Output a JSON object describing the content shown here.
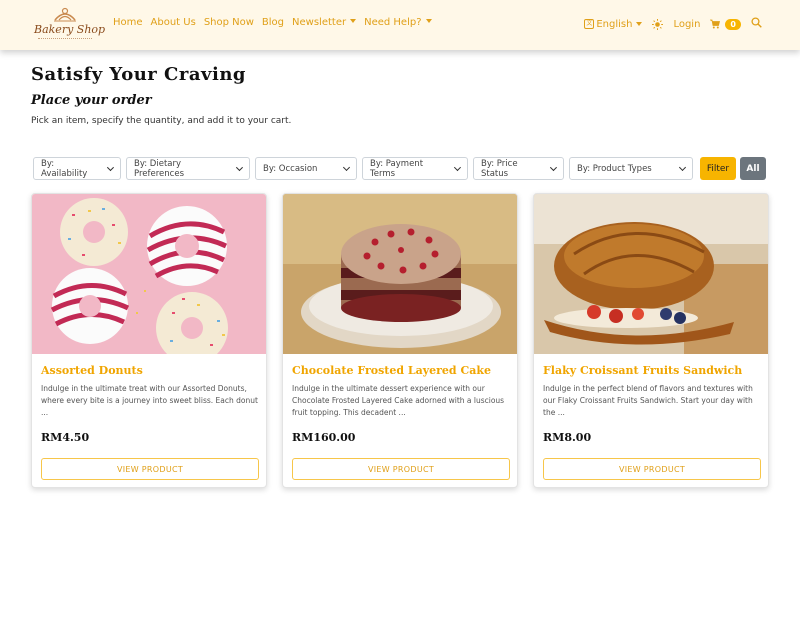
{
  "nav": {
    "logo_text": "Bakery Shop",
    "links": [
      {
        "label": "Home",
        "dropdown": false
      },
      {
        "label": "About Us",
        "dropdown": false
      },
      {
        "label": "Shop Now",
        "dropdown": false
      },
      {
        "label": "Blog",
        "dropdown": false
      },
      {
        "label": "Newsletter",
        "dropdown": true
      },
      {
        "label": "Need Help?",
        "dropdown": true
      }
    ],
    "language": "English",
    "login": "Login",
    "cart_count": "0",
    "icons": [
      "language-icon",
      "sun-icon",
      "cart-icon",
      "search-icon"
    ]
  },
  "header": {
    "title": "Satisfy Your Craving",
    "subtitle": "Place your order",
    "description": "Pick an item, specify the quantity, and add it to your cart."
  },
  "filters": {
    "selects": [
      "By: Availability",
      "By: Dietary Preferences",
      "By: Occasion",
      "By: Payment Terms",
      "By: Price Status",
      "By: Product Types"
    ],
    "filter_button": "Filter",
    "all_button": "All"
  },
  "products": [
    {
      "name": "Assorted Donuts",
      "description": "Indulge in the ultimate treat with our Assorted Donuts, where every bite is a journey into sweet bliss. Each donut ...",
      "price": "RM4.50",
      "button": "VIEW PRODUCT"
    },
    {
      "name": "Chocolate Frosted Layered Cake",
      "description": "Indulge in the ultimate dessert experience with our Chocolate Frosted Layered Cake adorned with a luscious fruit topping. This decadent ...",
      "price": "RM160.00",
      "button": "VIEW PRODUCT"
    },
    {
      "name": "Flaky Croissant Fruits Sandwich",
      "description": "Indulge in the perfect blend of flavors and textures with our Flaky Croissant Fruits Sandwich. Start your day with the ...",
      "price": "RM8.00",
      "button": "VIEW PRODUCT"
    }
  ],
  "colors": {
    "accent": "#f7b400",
    "link": "#e0a019",
    "navbar_bg": "#fff8e8",
    "all_button": "#6c757d"
  }
}
